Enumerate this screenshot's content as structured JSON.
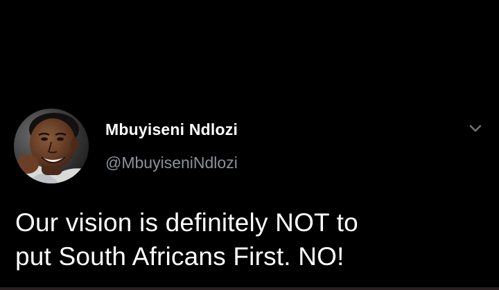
{
  "tweet": {
    "author": {
      "display_name": "Mbuyiseni Ndlozi",
      "handle": "@MbuyiseniNdlozi",
      "avatar_icon": "profile-photo"
    },
    "menu_icon": "chevron-down-icon",
    "text_lines": [
      "Our vision is definitely NOT to",
      "put South Africans First. NO!"
    ]
  },
  "colors": {
    "background": "#000000",
    "primary_text": "#ffffff",
    "secondary_text": "#8a939c"
  }
}
